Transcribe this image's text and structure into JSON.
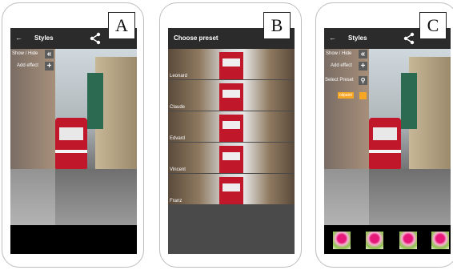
{
  "panels": {
    "a": {
      "letter": "A",
      "title": "Styles",
      "show_hide_label": "Show / Hide",
      "show_hide_icon": "double-chevron-left",
      "add_effect_label": "Add effect",
      "add_icon": "plus"
    },
    "b": {
      "letter": "B",
      "title": "Choose preset",
      "presets": [
        "Leonard",
        "Claude",
        "Edvard",
        "Vincent",
        "Franz"
      ]
    },
    "c": {
      "letter": "C",
      "title": "Styles",
      "show_hide_label": "Show / Hide",
      "add_effect_label": "Add effect",
      "select_preset_label": "Select Preset",
      "effect_tag": "oilpaint",
      "effect_color": "#f5a623",
      "thumbnail_count": 4
    }
  },
  "icons": {
    "back": "arrow-left",
    "share": "share",
    "search": "magnifier"
  }
}
